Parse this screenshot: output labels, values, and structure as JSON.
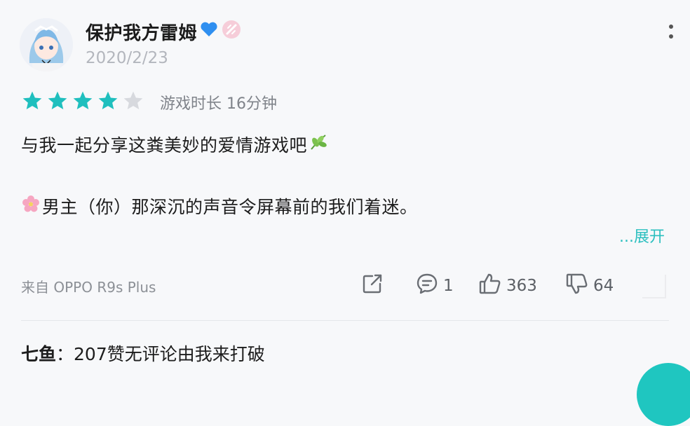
{
  "review": {
    "username": "保护我方雷姆",
    "date": "2020/2/23",
    "rating": 4,
    "max_rating": 5,
    "playtime": "游戏时长 16分钟",
    "line1": "与我一起分享这粪美妙的爱情游戏吧",
    "line2": "男主（你）那深沉的声音令屏幕前的我们着迷。",
    "expand_label": "...展开",
    "source": "来自 OPPO R9s Plus",
    "comments": "1",
    "likes": "363",
    "dislikes": "64"
  },
  "reply": {
    "author": "七鱼",
    "separator": "：",
    "text": "207赞无评论由我来打破"
  },
  "colors": {
    "accent": "#2bbfbf",
    "star_on": "#1fbfbe",
    "star_off": "#d7d9de"
  },
  "icons": {
    "heart": "blue-heart-icon",
    "badge": "sparkle-badge-icon",
    "leaf": "herb-leaf-icon",
    "flower": "cherry-blossom-icon",
    "share": "share-icon",
    "comment": "comment-icon",
    "like": "thumbs-up-icon",
    "dislike": "thumbs-down-icon",
    "more": "more-vertical-icon"
  }
}
